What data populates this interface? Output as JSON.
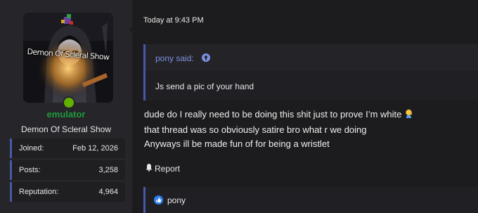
{
  "user": {
    "avatar_caption": "Demon Of Scleral Show",
    "username": "emulator",
    "title": "Demon Of Scleral Show",
    "stats": [
      {
        "label": "Joined:",
        "value": "Feb 12, 2026"
      },
      {
        "label": "Posts:",
        "value": "3,258"
      },
      {
        "label": "Reputation:",
        "value": "4,964"
      }
    ],
    "username_color": "#1e9b3c",
    "online_color": "#63b000"
  },
  "post": {
    "timestamp": "Today at 9:43 PM",
    "quote": {
      "author": "pony said:",
      "text": "Js send a pic of your hand"
    },
    "lines": [
      "dude do I really need to be doing this shit just to prove I’m white",
      "that thread was so obviously satire bro what r we doing",
      "Anyways ill be made fun of for being a wristlet"
    ],
    "emoji": "person-facepalming-emoji",
    "report_label": "Report",
    "reactions": {
      "icon": "like-icon",
      "user": "pony"
    }
  },
  "colors": {
    "accent": "#4a58a8",
    "quote_link": "#7c8fe0",
    "background": "#1c1c1e",
    "panel": "#26262a"
  }
}
